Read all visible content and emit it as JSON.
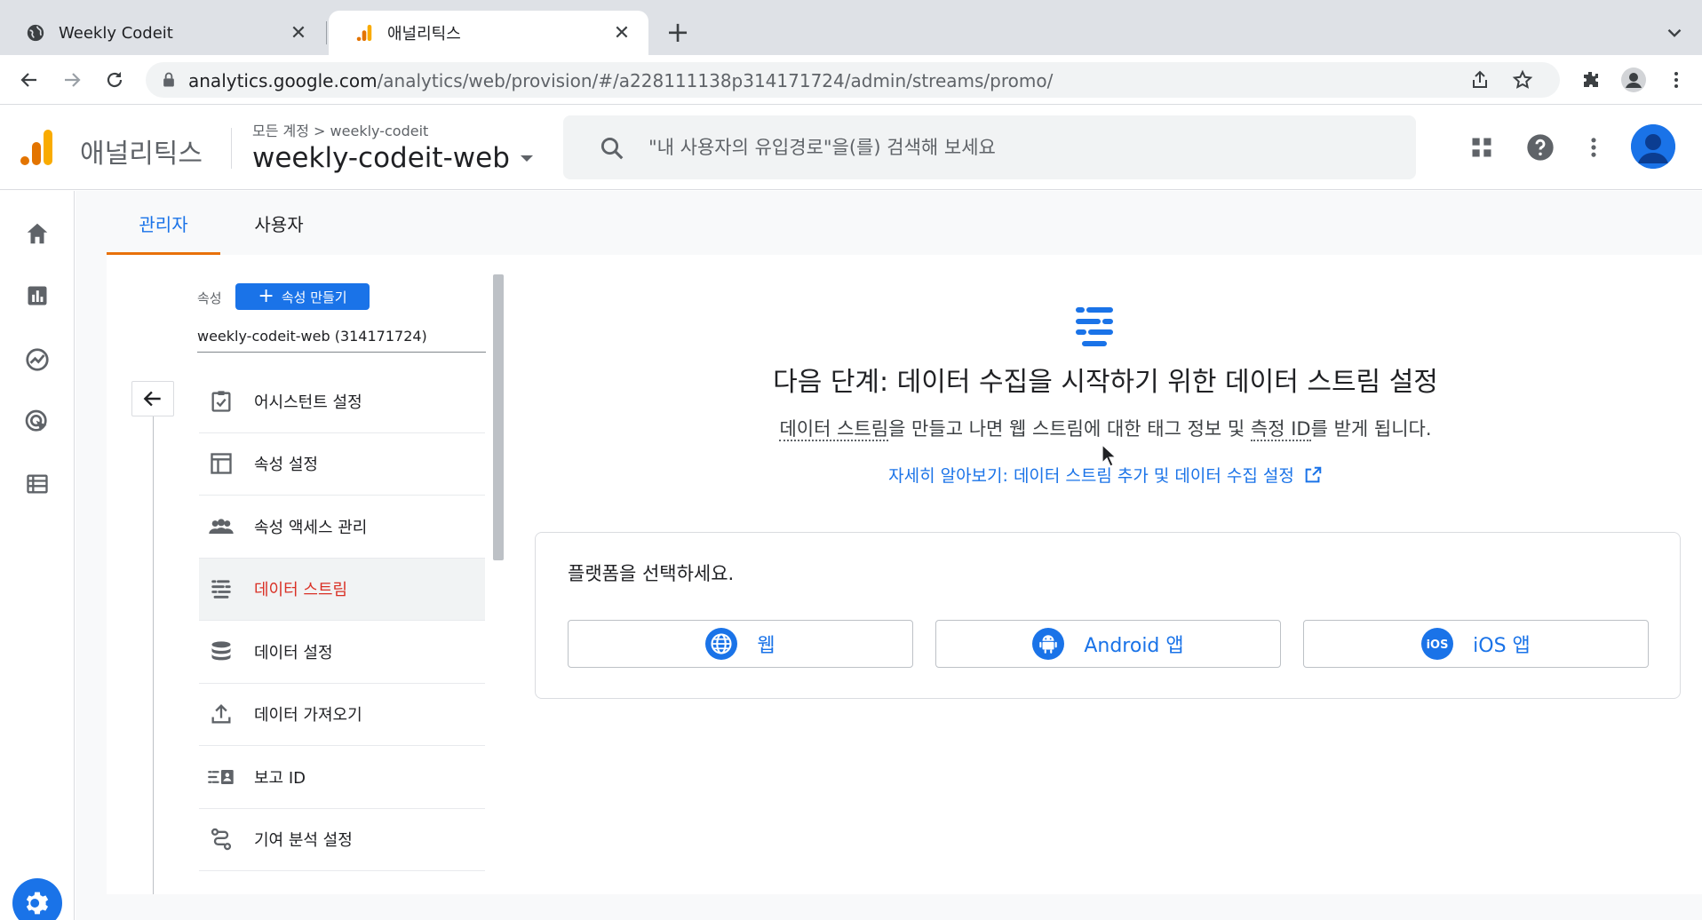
{
  "browser": {
    "tabs": [
      {
        "title": "Weekly Codeit",
        "favicon": "globe-icon"
      },
      {
        "title": "애널리틱스",
        "favicon": "analytics-icon"
      }
    ],
    "url_host": "analytics.google.com",
    "url_path": "/analytics/web/provision/#/a228111138p314171724/admin/streams/promo/"
  },
  "header": {
    "app_name": "애널리틱스",
    "breadcrumb": "모든 계정 > weekly-codeit",
    "property": "weekly-codeit-web",
    "search_placeholder": "\"내 사용자의 유입경로\"을(를) 검색해 보세요"
  },
  "subtabs": {
    "admin": "관리자",
    "user": "사용자"
  },
  "property_column": {
    "label": "속성",
    "create_button": "속성 만들기",
    "selected_property": "weekly-codeit-web (314171724)",
    "menu": [
      {
        "label": "어시스턴트 설정",
        "icon": "checklist-icon"
      },
      {
        "label": "속성 설정",
        "icon": "layout-icon"
      },
      {
        "label": "속성 액세스 관리",
        "icon": "people-icon"
      },
      {
        "label": "데이터 스트림",
        "icon": "data-stream-icon",
        "active": true
      },
      {
        "label": "데이터 설정",
        "icon": "database-icon"
      },
      {
        "label": "데이터 가져오기",
        "icon": "upload-icon"
      },
      {
        "label": "보고 ID",
        "icon": "reporting-id-icon"
      },
      {
        "label": "기여 분석 설정",
        "icon": "attribution-icon"
      }
    ]
  },
  "content": {
    "title": "다음 단계: 데이터 수집을 시작하기 위한 데이터 스트림 설정",
    "desc_part1": "데이터 스트림",
    "desc_part2": "을 만들고 나면 웹 스트림에 대한 태그 정보 및 ",
    "desc_part3": "측정 ID",
    "desc_part4": "를 받게 됩니다.",
    "link": "자세히 알아보기: 데이터 스트림 추가 및 데이터 수집 설정",
    "platform_title": "플랫폼을 선택하세요.",
    "platforms": [
      {
        "label": "웹",
        "icon": "globe-icon"
      },
      {
        "label": "Android 앱",
        "icon": "android-icon"
      },
      {
        "label": "iOS 앱",
        "icon": "ios-icon"
      }
    ]
  },
  "colors": {
    "accent": "#1a73e8",
    "active_text": "#d93025",
    "tab_underline": "#e8710a"
  }
}
